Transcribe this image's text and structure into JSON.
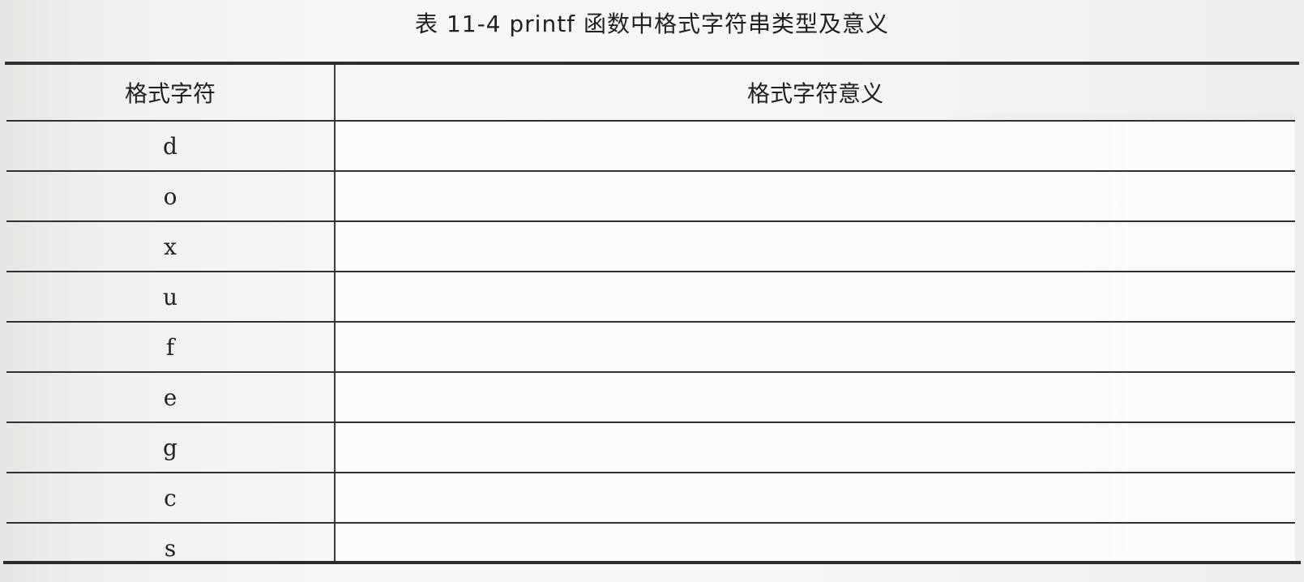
{
  "table": {
    "caption": "表 11-4    printf 函数中格式字符串类型及意义",
    "header_left": "格式字符",
    "header_right": "格式字符意义",
    "rows": [
      {
        "char": "d",
        "meaning": ""
      },
      {
        "char": "o",
        "meaning": ""
      },
      {
        "char": "x",
        "meaning": ""
      },
      {
        "char": "u",
        "meaning": ""
      },
      {
        "char": "f",
        "meaning": ""
      },
      {
        "char": "e",
        "meaning": ""
      },
      {
        "char": "g",
        "meaning": ""
      },
      {
        "char": "c",
        "meaning": ""
      },
      {
        "char": "s",
        "meaning": ""
      }
    ]
  }
}
